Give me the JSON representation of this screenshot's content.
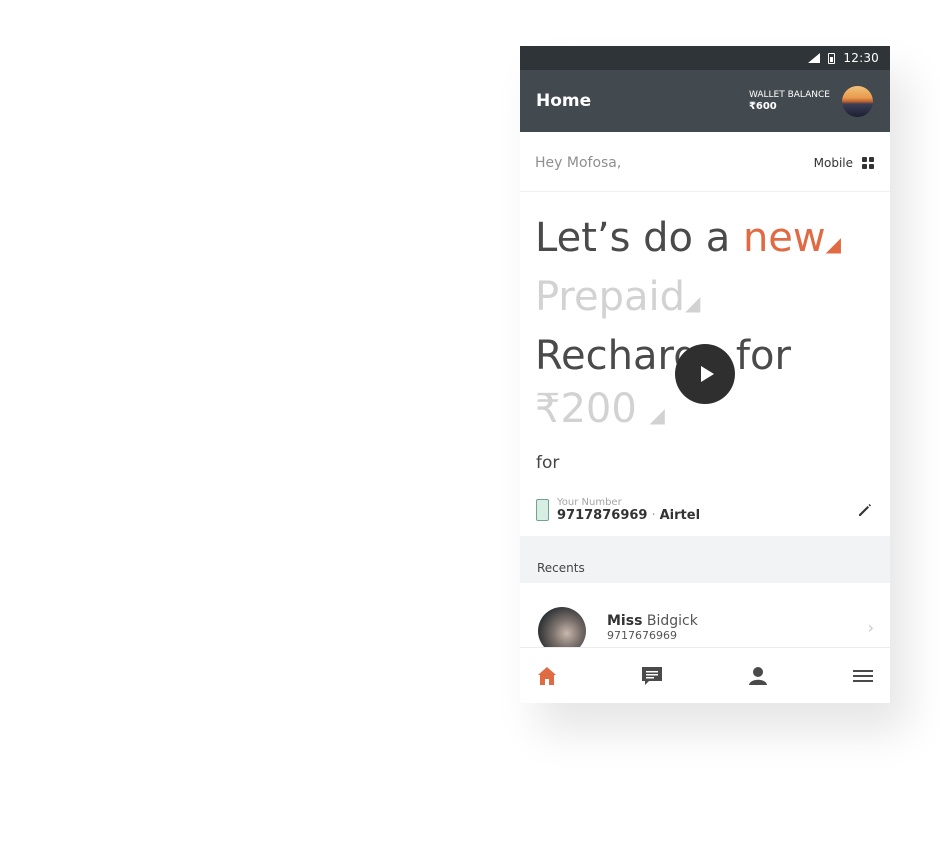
{
  "statusbar": {
    "time": "12:30"
  },
  "appbar": {
    "title": "Home",
    "wallet_label": "WALLET BALANCE",
    "wallet_amount": "₹600"
  },
  "greeting": {
    "text": "Hey Mofosa,",
    "mode_label": "Mobile"
  },
  "hero": {
    "line1_prefix": "Let’s do a",
    "line1_accent": "new",
    "line2": "Prepaid",
    "line3": "Recharge for",
    "line4": "₹200",
    "for_label": "for"
  },
  "number": {
    "label": "Your Number",
    "value": "9717876969",
    "operator": "Airtel",
    "separator": "·"
  },
  "recents": {
    "title": "Recents",
    "items": [
      {
        "title": "Miss",
        "name": "Bidgick",
        "number": "9717676969"
      }
    ]
  },
  "colors": {
    "accent": "#e06b43",
    "appbar": "#434a4f",
    "statusbar": "#2e3438"
  },
  "icons": [
    "home-icon",
    "chat-icon",
    "profile-icon",
    "menu-icon",
    "pencil-icon",
    "grid-icon",
    "play-icon"
  ]
}
